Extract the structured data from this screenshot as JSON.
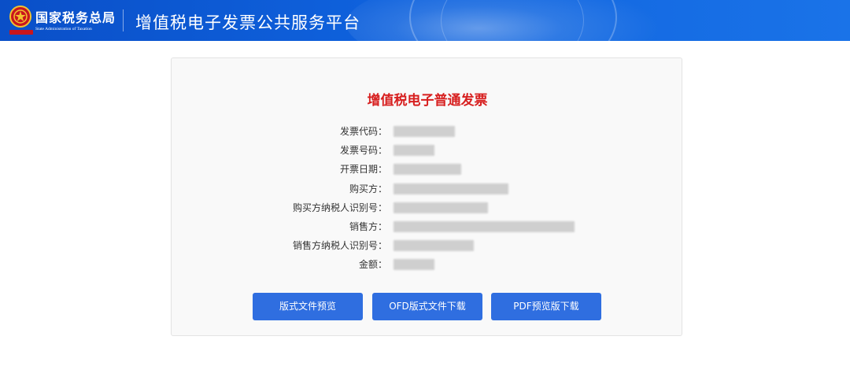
{
  "header": {
    "agency_name": "国家税务总局",
    "agency_name_en": "State Administration of Taxation",
    "platform_title": "增值税电子发票公共服务平台"
  },
  "invoice": {
    "title": "增值税电子普通发票",
    "fields": [
      {
        "label": "发票代码：",
        "value": ""
      },
      {
        "label": "发票号码：",
        "value": ""
      },
      {
        "label": "开票日期：",
        "value": ""
      },
      {
        "label": "购买方：",
        "value": ""
      },
      {
        "label": "购买方纳税人识别号：",
        "value": ""
      },
      {
        "label": "销售方：",
        "value": ""
      },
      {
        "label": "销售方纳税人识别号：",
        "value": ""
      },
      {
        "label": "金额：",
        "value": ""
      }
    ]
  },
  "actions": {
    "preview_label": "版式文件预览",
    "ofd_download_label": "OFD版式文件下载",
    "pdf_download_label": "PDF预览版下载"
  },
  "colors": {
    "header_blue": "#0f62dd",
    "title_red": "#d71f1f",
    "button_blue": "#2f6ee0"
  }
}
